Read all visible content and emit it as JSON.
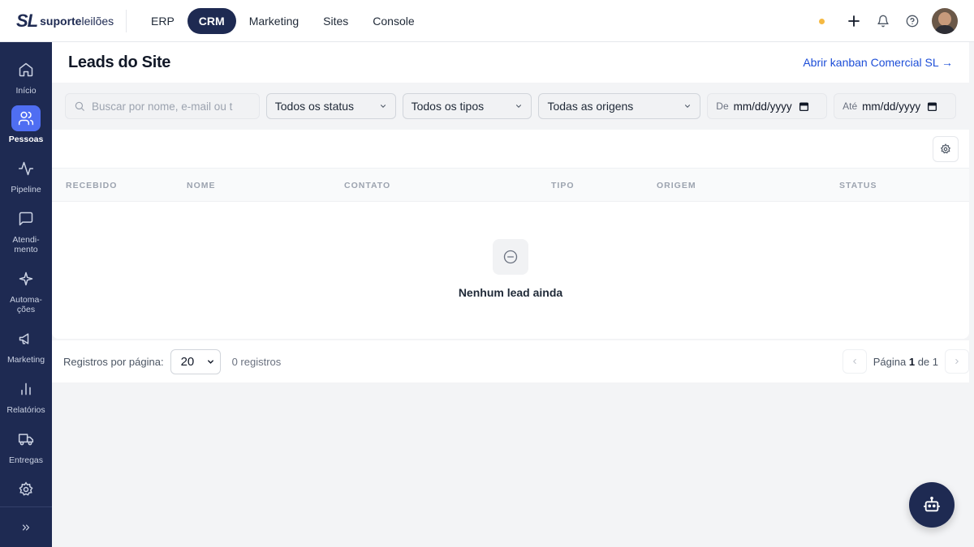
{
  "brand": {
    "mark": "SL",
    "name_bold": "suporte",
    "name_light": "leilões"
  },
  "topnav": {
    "tabs": [
      {
        "label": "ERP",
        "active": false
      },
      {
        "label": "CRM",
        "active": true
      },
      {
        "label": "Marketing",
        "active": false
      },
      {
        "label": "Sites",
        "active": false
      },
      {
        "label": "Console",
        "active": false
      }
    ]
  },
  "topbar_icons": [
    "status-dot",
    "plus-icon",
    "bell-icon",
    "help-icon",
    "avatar"
  ],
  "sidebar": {
    "items": [
      {
        "label": "Início",
        "icon": "home-icon"
      },
      {
        "label": "Pessoas",
        "icon": "users-icon",
        "active": true
      },
      {
        "label": "Pipeline",
        "icon": "activity-icon"
      },
      {
        "label": "Atendi-\nmento",
        "icon": "message-icon"
      },
      {
        "label": "Automa-\nções",
        "icon": "sparkle-icon"
      },
      {
        "label": "Marketing",
        "icon": "megaphone-icon"
      },
      {
        "label": "Relatórios",
        "icon": "bar-chart-icon"
      },
      {
        "label": "Entregas",
        "icon": "truck-icon"
      },
      {
        "label": "",
        "icon": "settings-icon"
      }
    ],
    "collapse_icon": "chevrons-right-icon"
  },
  "page": {
    "title": "Leads do Site",
    "kanban_link": "Abrir kanban Comercial SL →"
  },
  "filters": {
    "search_placeholder": "Buscar por nome, e-mail ou t",
    "status": "Todos os status",
    "types": "Todos os tipos",
    "origins": "Todas as origens",
    "from_label": "De",
    "from_value": "mm/dd/yyyy",
    "to_label": "Até",
    "to_value": "mm/dd/yyyy"
  },
  "table": {
    "columns": [
      "RECEBIDO",
      "NOME",
      "CONTATO",
      "TIPO",
      "ORIGEM",
      "STATUS"
    ],
    "empty_message": "Nenhum lead ainda"
  },
  "pagination": {
    "per_page_label": "Registros por página:",
    "per_page_value": "20",
    "count": "0 registros",
    "page_prefix": "Página",
    "page_current": "1",
    "page_of": "de 1"
  },
  "colors": {
    "navy": "#1e2a52",
    "active_blue": "#4f6ef2",
    "link": "#1d4ed8",
    "status_dot": "#f5b942"
  }
}
